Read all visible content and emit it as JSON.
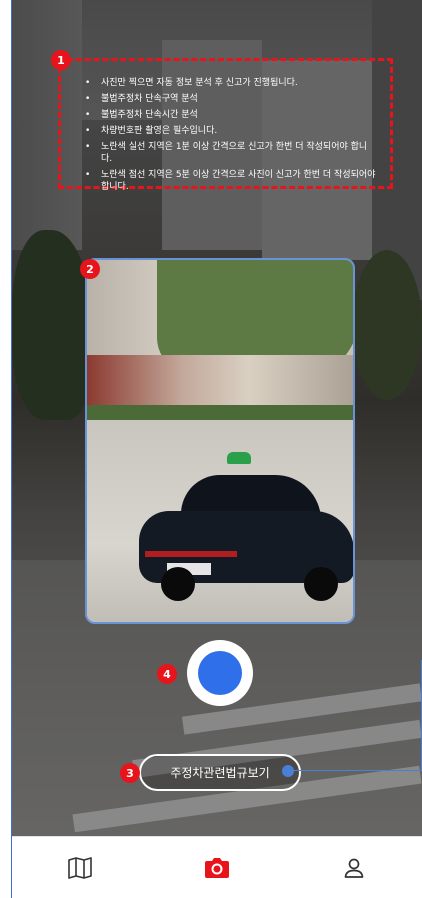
{
  "guide": {
    "items": [
      "사진만 찍으면 자동 정보 분석 후 신고가 진행됩니다.",
      "불법주정차 단속구역 분석",
      "불법주정차 단속시간 분석",
      "차량번호판 촬영은 필수입니다.",
      "노란색 실선 지역은 1분 이상 간격으로 신고가 한번 더 작성되어야 합니다.",
      "노란색 점선 지역은 5분 이상 간격으로 사진이 신고가 한번 더 작성되어야 합니다."
    ]
  },
  "markers": [
    "1",
    "2",
    "3",
    "4"
  ],
  "law_button": {
    "label": "주정차관련법규보기"
  },
  "nav": {
    "items": [
      {
        "icon": "map-icon",
        "active": false
      },
      {
        "icon": "camera-icon",
        "active": true
      },
      {
        "icon": "user-icon",
        "active": false
      }
    ]
  },
  "colors": {
    "accent": "#2f6fea",
    "marker": "#e8141c",
    "nav_active": "#e8141c",
    "nav_inactive": "#333333",
    "frame_border": "#6a93d6"
  }
}
